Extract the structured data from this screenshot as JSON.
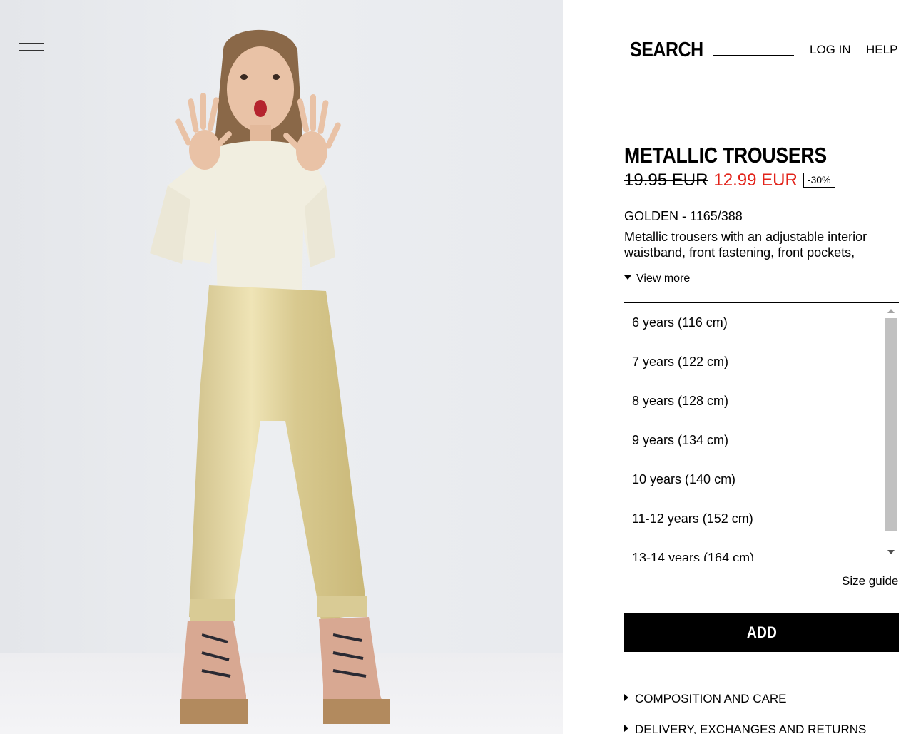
{
  "header": {
    "menu_icon": "hamburger-menu-icon",
    "search_label": "SEARCH",
    "login_label": "LOG IN",
    "help_label": "HELP"
  },
  "product": {
    "title": "METALLIC TROUSERS",
    "old_price": "19.95 EUR",
    "new_price": "12.99 EUR",
    "discount": "-30%",
    "color_ref": "GOLDEN - 1165/388",
    "description": "Metallic trousers with an adjustable interior waistband, front fastening, front pockets,",
    "view_more_label": "View more",
    "price_color": "#e2231a"
  },
  "sizes": [
    "6 years (116 cm)",
    "7 years (122 cm)",
    "8 years (128 cm)",
    "9 years (134 cm)",
    "10 years (140 cm)",
    "11-12 years (152 cm)",
    "13-14 years (164 cm)"
  ],
  "size_guide_label": "Size guide",
  "add_button_label": "ADD",
  "accordions": [
    "COMPOSITION AND CARE",
    "DELIVERY, EXCHANGES AND RETURNS"
  ]
}
